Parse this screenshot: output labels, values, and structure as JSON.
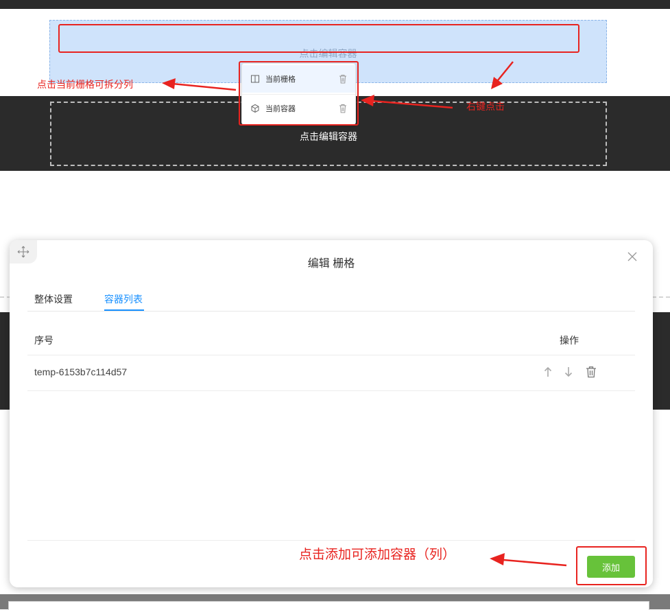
{
  "canvas": {
    "top_grid_placeholder": "点击编辑容器",
    "bottom_container_placeholder": "点击编辑容器"
  },
  "context_menu": {
    "items": [
      {
        "label": "当前栅格",
        "icon": "columns-icon"
      },
      {
        "label": "当前容器",
        "icon": "cube-icon"
      }
    ]
  },
  "annotations": {
    "left": "点击当前栅格可拆分列",
    "right": "右键点击",
    "add": "点击添加可添加容器（列）",
    "color": "#e8231f"
  },
  "modal": {
    "title": "编辑 栅格",
    "tabs": [
      {
        "label": "整体设置",
        "active": false
      },
      {
        "label": "容器列表",
        "active": true
      }
    ],
    "table": {
      "columns": {
        "seq": "序号",
        "actions": "操作"
      },
      "rows": [
        {
          "id": "temp-6153b7c114d57"
        }
      ]
    },
    "add_label": "添加"
  },
  "colors": {
    "accent_blue": "#1890ff",
    "add_green": "#67c23a",
    "dark_band": "#2b2b2b",
    "grid_fill": "#cfe3fb"
  }
}
